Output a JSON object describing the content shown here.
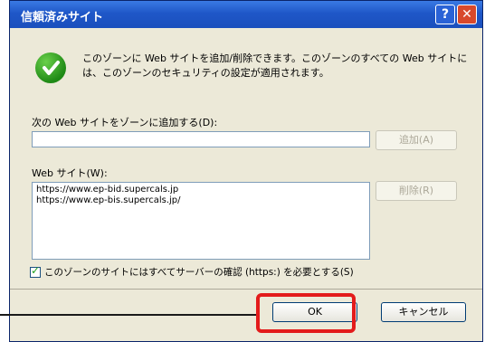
{
  "window": {
    "title": "信頼済みサイト",
    "help_label": "?",
    "close_label": "✕"
  },
  "description": "このゾーンに Web サイトを追加/削除できます。このゾーンのすべての Web サイトには、このゾーンのセキュリティの設定が適用されます。",
  "add_section": {
    "label": "次の Web サイトをゾーンに追加する(D):",
    "input_value": "",
    "add_button": "追加(A)"
  },
  "sites_section": {
    "label": "Web サイト(W):",
    "sites": [
      "https://www.ep-bid.supercals.jp",
      "https://www.ep-bis.supercals.jp/"
    ],
    "remove_button": "削除(R)"
  },
  "checkbox": {
    "label": "このゾーンのサイトにはすべてサーバーの確認 (https:) を必要とする(S)",
    "checked": true
  },
  "buttons": {
    "ok": "OK",
    "cancel": "キャンセル"
  },
  "colors": {
    "titlebar": "#1f57c8",
    "highlight": "#e31b1b",
    "dialog_bg": "#ece9d8"
  }
}
